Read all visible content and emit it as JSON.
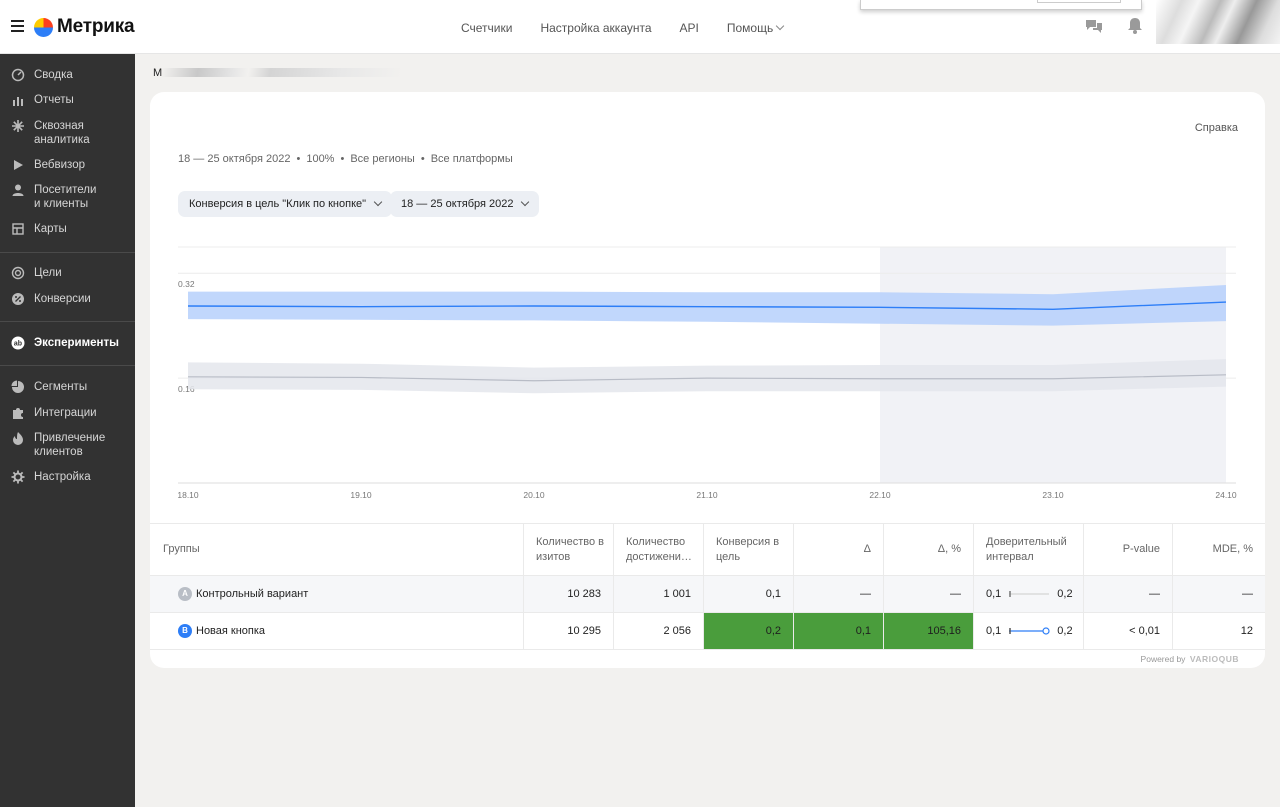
{
  "app": {
    "title": "Метрика"
  },
  "topnav": [
    "Счетчики",
    "Настройка аккаунта",
    "API",
    "Помощь"
  ],
  "sidebar": {
    "items": [
      {
        "label": "Сводка",
        "icon": "dashboard-icon"
      },
      {
        "label": "Отчеты",
        "icon": "bar-chart-icon"
      },
      {
        "label": "Сквозная\nаналитика",
        "icon": "asterisk-icon"
      },
      {
        "label": "Вебвизор",
        "icon": "play-icon"
      },
      {
        "label": "Посетители\nи клиенты",
        "icon": "person-icon"
      },
      {
        "label": "Карты",
        "icon": "map-icon"
      },
      {
        "label": "Цели",
        "icon": "target-icon"
      },
      {
        "label": "Конверсии",
        "icon": "percent-icon"
      },
      {
        "label": "Эксперименты",
        "icon": "ab-icon"
      },
      {
        "label": "Сегменты",
        "icon": "pie-icon"
      },
      {
        "label": "Интеграции",
        "icon": "puzzle-icon"
      },
      {
        "label": "Привлечение\nклиентов",
        "icon": "flame-icon"
      },
      {
        "label": "Настройка",
        "icon": "gear-icon"
      }
    ]
  },
  "breadcrumb": "М",
  "card": {
    "help": "Справка",
    "meta": {
      "dates": "18 — 25 октября 2022",
      "percent": "100%",
      "regions": "Все регионы",
      "platforms": "Все платформы"
    },
    "filters": {
      "goal": "Конверсия в цель \"Клик по кнопке\"",
      "period": "18 — 25 октября 2022"
    }
  },
  "chart_data": {
    "type": "line",
    "title": "",
    "x": [
      "18.10",
      "19.10",
      "20.10",
      "21.10",
      "22.10",
      "23.10",
      "24.10"
    ],
    "yticks": [
      0.16,
      0.32
    ],
    "ylim": [
      0,
      0.36
    ],
    "highlight_from": "22.10",
    "series": [
      {
        "values": [
          0.27,
          0.269,
          0.27,
          0.269,
          0.268,
          0.265,
          0.276
        ],
        "lower": [
          0.25,
          0.249,
          0.248,
          0.246,
          0.243,
          0.24,
          0.247
        ],
        "upper": [
          0.292,
          0.292,
          0.292,
          0.291,
          0.291,
          0.288,
          0.302
        ],
        "color": "#2d7ef7",
        "band": "#b6d0fb"
      },
      {
        "values": [
          0.162,
          0.161,
          0.156,
          0.16,
          0.159,
          0.159,
          0.165
        ],
        "lower": [
          0.143,
          0.142,
          0.137,
          0.14,
          0.14,
          0.14,
          0.147
        ],
        "upper": [
          0.184,
          0.182,
          0.176,
          0.179,
          0.18,
          0.18,
          0.189
        ],
        "color": "#b8bcc6",
        "band": "#e4e6ec"
      }
    ]
  },
  "table": {
    "headers": [
      "Группы",
      "Количество в изитов",
      "Количество достижени…",
      "Конверсия в цель",
      "Δ",
      "Δ, %",
      "Доверительный интервал",
      "P-value",
      "MDE, %"
    ],
    "rows": [
      {
        "badge": "A",
        "name": "Контрольный вариант",
        "visits": "10 283",
        "achievements": "1 001",
        "conversion": "0,1",
        "delta": "—",
        "delta_pct": "—",
        "ci_low": "0,1",
        "ci_high": "0,2",
        "pvalue": "—",
        "mde": "—"
      },
      {
        "badge": "B",
        "name": "Новая кнопка",
        "visits": "10 295",
        "achievements": "2 056",
        "conversion": "0,2",
        "delta": "0,1",
        "delta_pct": "105,16",
        "ci_low": "0,1",
        "ci_high": "0,2",
        "pvalue": "< 0,01",
        "mde": "12"
      }
    ]
  },
  "powered": {
    "text": "Powered by",
    "brand": "VARIOQUB"
  },
  "colors": {
    "sidebar": "#323232",
    "accent": "#2d7ef7",
    "positive": "#4a9d3c"
  }
}
